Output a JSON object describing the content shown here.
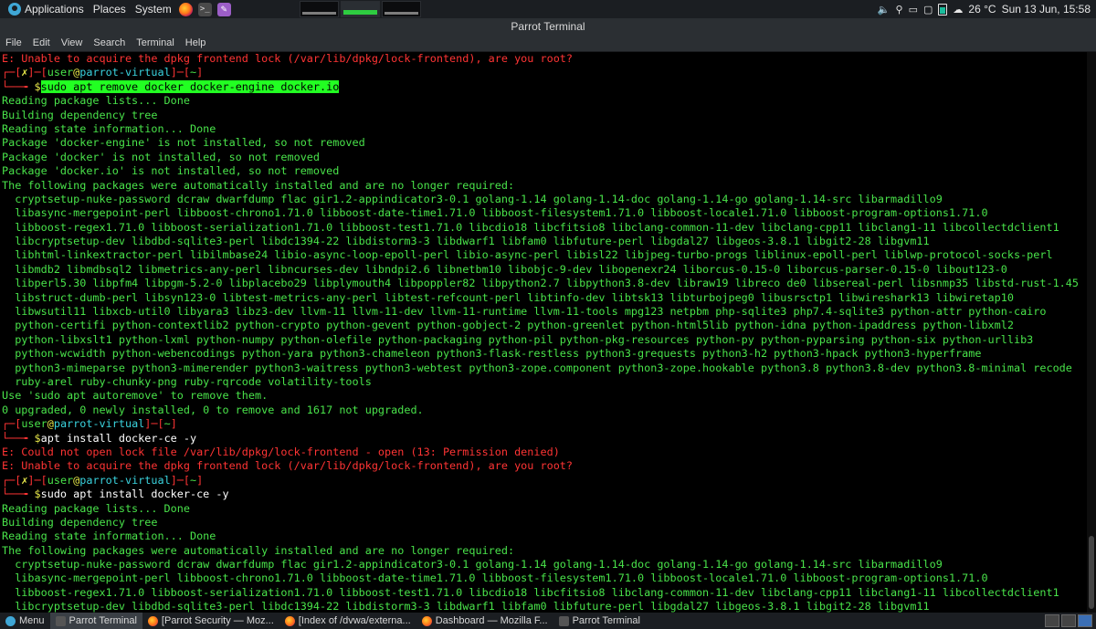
{
  "top_panel": {
    "applications": "Applications",
    "places": "Places",
    "system": "System",
    "weather": "26 °C",
    "clock": "Sun 13 Jun, 15:58"
  },
  "window": {
    "title": "Parrot Terminal",
    "menu": [
      "File",
      "Edit",
      "View",
      "Search",
      "Terminal",
      "Help"
    ]
  },
  "terminal": {
    "lines": [
      [
        {
          "t": "E: Unable to acquire the dpkg frontend lock (/var/lib/dpkg/lock-frontend), are you root?",
          "c": "r"
        }
      ],
      [
        {
          "t": "┌─[",
          "c": "r"
        },
        {
          "t": "✗",
          "c": "y"
        },
        {
          "t": "]─[",
          "c": "r"
        },
        {
          "t": "user",
          "c": "g"
        },
        {
          "t": "@",
          "c": "y"
        },
        {
          "t": "parrot-virtual",
          "c": "c"
        },
        {
          "t": "]─[",
          "c": "r"
        },
        {
          "t": "~",
          "c": "g"
        },
        {
          "t": "]",
          "c": "r"
        }
      ],
      [
        {
          "t": "└──╼ ",
          "c": "r"
        },
        {
          "t": "$",
          "c": "y"
        },
        {
          "t": "sudo apt remove docker docker-engine docker.io",
          "c": "hl"
        }
      ],
      [
        {
          "t": "Reading package lists... Done",
          "c": "g"
        }
      ],
      [
        {
          "t": "Building dependency tree",
          "c": "g"
        }
      ],
      [
        {
          "t": "Reading state information... Done",
          "c": "g"
        }
      ],
      [
        {
          "t": "Package 'docker-engine' is not installed, so not removed",
          "c": "g"
        }
      ],
      [
        {
          "t": "Package 'docker' is not installed, so not removed",
          "c": "g"
        }
      ],
      [
        {
          "t": "Package 'docker.io' is not installed, so not removed",
          "c": "g"
        }
      ],
      [
        {
          "t": "The following packages were automatically installed and are no longer required:",
          "c": "g"
        }
      ],
      [
        {
          "t": "  cryptsetup-nuke-password dcraw dwarfdump flac gir1.2-appindicator3-0.1 golang-1.14 golang-1.14-doc golang-1.14-go golang-1.14-src libarmadillo9",
          "c": "g"
        }
      ],
      [
        {
          "t": "  libasync-mergepoint-perl libboost-chrono1.71.0 libboost-date-time1.71.0 libboost-filesystem1.71.0 libboost-locale1.71.0 libboost-program-options1.71.0",
          "c": "g"
        }
      ],
      [
        {
          "t": "  libboost-regex1.71.0 libboost-serialization1.71.0 libboost-test1.71.0 libcdio18 libcfitsio8 libclang-common-11-dev libclang-cpp11 libclang1-11 libcollectdclient1",
          "c": "g"
        }
      ],
      [
        {
          "t": "  libcryptsetup-dev libdbd-sqlite3-perl libdc1394-22 libdistorm3-3 libdwarf1 libfam0 libfuture-perl libgdal27 libgeos-3.8.1 libgit2-28 libgvm11",
          "c": "g"
        }
      ],
      [
        {
          "t": "  libhtml-linkextractor-perl libilmbase24 libio-async-loop-epoll-perl libio-async-perl libisl22 libjpeg-turbo-progs liblinux-epoll-perl liblwp-protocol-socks-perl",
          "c": "g"
        }
      ],
      [
        {
          "t": "  libmdb2 libmdbsql2 libmetrics-any-perl libncurses-dev libndpi2.6 libnetbm10 libobjc-9-dev libopenexr24 liborcus-0.15-0 liborcus-parser-0.15-0 libout123-0",
          "c": "g"
        }
      ],
      [
        {
          "t": "  libperl5.30 libpfm4 libpgm-5.2-0 libplacebo29 libplymouth4 libpoppler82 libpython2.7 libpython3.8-dev libraw19 libreco de0 libsereal-perl libsnmp35 libstd-rust-1.45",
          "c": "g"
        }
      ],
      [
        {
          "t": "  libstruct-dumb-perl libsyn123-0 libtest-metrics-any-perl libtest-refcount-perl libtinfo-dev libtsk13 libturbojpeg0 libusrsctp1 libwireshark13 libwiretap10",
          "c": "g"
        }
      ],
      [
        {
          "t": "  libwsutil11 libxcb-util0 libyara3 libz3-dev llvm-11 llvm-11-dev llvm-11-runtime llvm-11-tools mpg123 netpbm php-sqlite3 php7.4-sqlite3 python-attr python-cairo",
          "c": "g"
        }
      ],
      [
        {
          "t": "  python-certifi python-contextlib2 python-crypto python-gevent python-gobject-2 python-greenlet python-html5lib python-idna python-ipaddress python-libxml2",
          "c": "g"
        }
      ],
      [
        {
          "t": "  python-libxslt1 python-lxml python-numpy python-olefile python-packaging python-pil python-pkg-resources python-py python-pyparsing python-six python-urllib3",
          "c": "g"
        }
      ],
      [
        {
          "t": "  python-wcwidth python-webencodings python-yara python3-chameleon python3-flask-restless python3-grequests python3-h2 python3-hpack python3-hyperframe",
          "c": "g"
        }
      ],
      [
        {
          "t": "  python3-mimeparse python3-mimerender python3-waitress python3-webtest python3-zope.component python3-zope.hookable python3.8 python3.8-dev python3.8-minimal recode",
          "c": "g"
        }
      ],
      [
        {
          "t": "  ruby-arel ruby-chunky-png ruby-rqrcode volatility-tools",
          "c": "g"
        }
      ],
      [
        {
          "t": "Use 'sudo apt autoremove' to remove them.",
          "c": "g"
        }
      ],
      [
        {
          "t": "0 upgraded, 0 newly installed, 0 to remove and 1617 not upgraded.",
          "c": "g"
        }
      ],
      [
        {
          "t": "┌─[",
          "c": "r"
        },
        {
          "t": "user",
          "c": "g"
        },
        {
          "t": "@",
          "c": "y"
        },
        {
          "t": "parrot-virtual",
          "c": "c"
        },
        {
          "t": "]─[",
          "c": "r"
        },
        {
          "t": "~",
          "c": "g"
        },
        {
          "t": "]",
          "c": "r"
        }
      ],
      [
        {
          "t": "└──╼ ",
          "c": "r"
        },
        {
          "t": "$",
          "c": "y"
        },
        {
          "t": "apt install docker-ce -y",
          "c": "wh"
        }
      ],
      [
        {
          "t": "E: Could not open lock file /var/lib/dpkg/lock-frontend - open (13: Permission denied)",
          "c": "r"
        }
      ],
      [
        {
          "t": "E: Unable to acquire the dpkg frontend lock (/var/lib/dpkg/lock-frontend), are you root?",
          "c": "r"
        }
      ],
      [
        {
          "t": "┌─[",
          "c": "r"
        },
        {
          "t": "✗",
          "c": "y"
        },
        {
          "t": "]─[",
          "c": "r"
        },
        {
          "t": "user",
          "c": "g"
        },
        {
          "t": "@",
          "c": "y"
        },
        {
          "t": "parrot-virtual",
          "c": "c"
        },
        {
          "t": "]─[",
          "c": "r"
        },
        {
          "t": "~",
          "c": "g"
        },
        {
          "t": "]",
          "c": "r"
        }
      ],
      [
        {
          "t": "└──╼ ",
          "c": "r"
        },
        {
          "t": "$",
          "c": "y"
        },
        {
          "t": "sudo apt install docker-ce -y",
          "c": "wh"
        }
      ],
      [
        {
          "t": "Reading package lists... Done",
          "c": "g"
        }
      ],
      [
        {
          "t": "Building dependency tree",
          "c": "g"
        }
      ],
      [
        {
          "t": "Reading state information... Done",
          "c": "g"
        }
      ],
      [
        {
          "t": "The following packages were automatically installed and are no longer required:",
          "c": "g"
        }
      ],
      [
        {
          "t": "  cryptsetup-nuke-password dcraw dwarfdump flac gir1.2-appindicator3-0.1 golang-1.14 golang-1.14-doc golang-1.14-go golang-1.14-src libarmadillo9",
          "c": "g"
        }
      ],
      [
        {
          "t": "  libasync-mergepoint-perl libboost-chrono1.71.0 libboost-date-time1.71.0 libboost-filesystem1.71.0 libboost-locale1.71.0 libboost-program-options1.71.0",
          "c": "g"
        }
      ],
      [
        {
          "t": "  libboost-regex1.71.0 libboost-serialization1.71.0 libboost-test1.71.0 libcdio18 libcfitsio8 libclang-common-11-dev libclang-cpp11 libclang1-11 libcollectdclient1",
          "c": "g"
        }
      ],
      [
        {
          "t": "  libcryptsetup-dev libdbd-sqlite3-perl libdc1394-22 libdistorm3-3 libdwarf1 libfam0 libfuture-perl libgdal27 libgeos-3.8.1 libgit2-28 libgvm11",
          "c": "g"
        }
      ]
    ]
  },
  "taskbar": {
    "menu": "Menu",
    "items": [
      {
        "label": "Parrot Terminal",
        "icon": "terminal-icon",
        "active": true
      },
      {
        "label": "[Parrot Security — Moz...",
        "icon": "firefox-icon",
        "active": false
      },
      {
        "label": "[Index of /dvwa/externa...",
        "icon": "firefox-icon",
        "active": false
      },
      {
        "label": "Dashboard — Mozilla F...",
        "icon": "firefox-icon",
        "active": false
      },
      {
        "label": "Parrot Terminal",
        "icon": "terminal-icon",
        "active": false
      }
    ]
  }
}
